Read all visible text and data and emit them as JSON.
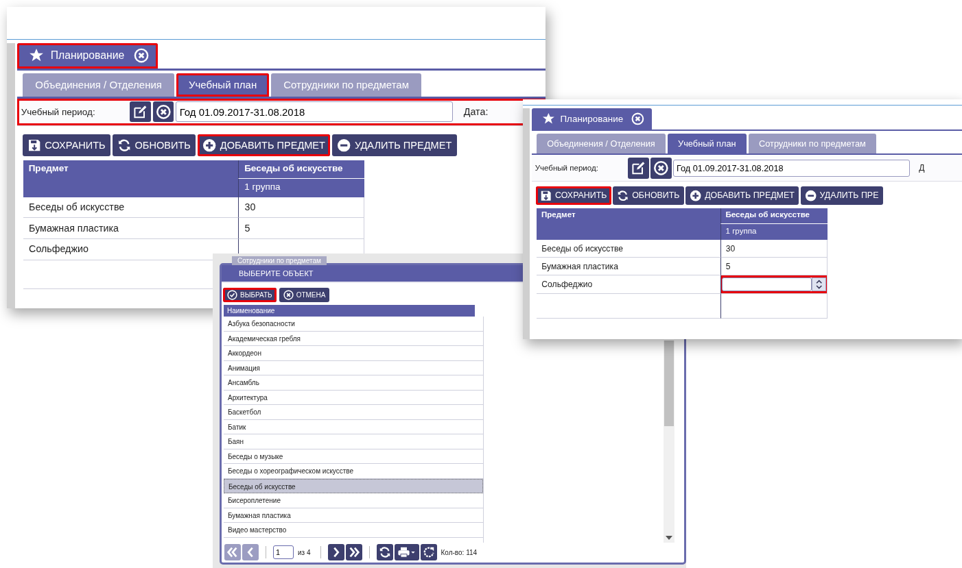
{
  "planning_views": [
    {
      "module_tab": {
        "label": "Планирование",
        "highlighted": true
      },
      "tabs": [
        {
          "label": "Объединения / Отделения",
          "selected": false,
          "highlighted": false
        },
        {
          "label": "Учебный план",
          "selected": true,
          "highlighted": true
        },
        {
          "label": "Сотрудники по предметам",
          "selected": false,
          "highlighted": false
        }
      ],
      "period": {
        "label": "Учебный период:",
        "value": "Год 01.09.2017-31.08.2018",
        "highlighted": true
      },
      "date_label": "Дата:",
      "toolbar": [
        {
          "kind": "save",
          "label": "СОХРАНИТЬ",
          "highlighted": false
        },
        {
          "kind": "refresh",
          "label": "ОБНОВИТЬ",
          "highlighted": false
        },
        {
          "kind": "add",
          "label": "ДОБАВИТЬ ПРЕДМЕТ",
          "highlighted": true
        },
        {
          "kind": "remove",
          "label": "УДАЛИТЬ ПРЕДМЕТ",
          "highlighted": false
        }
      ],
      "table": {
        "columns": [
          "Предмет",
          "Беседы об искусстве"
        ],
        "subheader": "1 группа",
        "rows": [
          {
            "subject": "Беседы об искусстве",
            "value": "30",
            "editing": false,
            "highlighted": false
          },
          {
            "subject": "Бумажная пластика",
            "value": "5",
            "editing": false,
            "highlighted": false
          },
          {
            "subject": "Сольфеджио",
            "editing": false,
            "highlighted": false
          }
        ]
      }
    },
    {
      "module_tab": {
        "label": "Планирование",
        "highlighted": false
      },
      "tabs": [
        {
          "label": "Объединения / Отделения",
          "selected": false,
          "highlighted": false
        },
        {
          "label": "Учебный план",
          "selected": true,
          "highlighted": false
        },
        {
          "label": "Сотрудники по предметам",
          "selected": false,
          "highlighted": false
        }
      ],
      "period": {
        "label": "Учебный период:",
        "value": "Год 01.09.2017-31.08.2018",
        "highlighted": false
      },
      "date_label": "Д",
      "toolbar": [
        {
          "kind": "save",
          "label": "СОХРАНИТЬ",
          "highlighted": true
        },
        {
          "kind": "refresh",
          "label": "ОБНОВИТЬ",
          "highlighted": false
        },
        {
          "kind": "add",
          "label": "ДОБАВИТЬ ПРЕДМЕТ",
          "highlighted": false
        },
        {
          "kind": "remove",
          "label": "УДАЛИТЬ ПРЕ",
          "highlighted": false
        }
      ],
      "table": {
        "columns": [
          "Предмет",
          "Беседы об искусстве"
        ],
        "subheader": "1 группа",
        "rows": [
          {
            "subject": "Беседы об искусстве",
            "value": "30",
            "editing": false,
            "highlighted": false
          },
          {
            "subject": "Бумажная пластика",
            "value": "5",
            "editing": false,
            "highlighted": false
          },
          {
            "subject": "Сольфеджио",
            "editing": true,
            "highlighted": true
          }
        ]
      }
    }
  ],
  "picker_dialog": {
    "background_tab": "Сотрудники по предметам",
    "title": "ВЫБЕРИТЕ ОБЪЕКТ",
    "buttons": [
      {
        "kind": "choose",
        "label": "ВЫБРАТЬ",
        "highlighted": true
      },
      {
        "kind": "cancel",
        "label": "ОТМЕНА",
        "highlighted": false
      }
    ],
    "column": "Наименование",
    "rows": [
      {
        "name": "Азбука безопасности",
        "selected": false
      },
      {
        "name": "Академическая гребля",
        "selected": false
      },
      {
        "name": "Аккордеон",
        "selected": false
      },
      {
        "name": "Анимация",
        "selected": false
      },
      {
        "name": "Ансамбль",
        "selected": false
      },
      {
        "name": "Архитектура",
        "selected": false
      },
      {
        "name": "Баскетбол",
        "selected": false
      },
      {
        "name": "Батик",
        "selected": false
      },
      {
        "name": "Баян",
        "selected": false
      },
      {
        "name": "Беседы о музыке",
        "selected": false
      },
      {
        "name": "Беседы о хореографическом искусстве",
        "selected": false
      },
      {
        "name": "Беседы об искусстве",
        "selected": true
      },
      {
        "name": "Бисероплетение",
        "selected": false
      },
      {
        "name": "Бумажная пластика",
        "selected": false
      },
      {
        "name": "Видео мастерство",
        "selected": false
      }
    ],
    "pager": {
      "buttons": [
        {
          "kind": "first",
          "disabled": true
        },
        {
          "kind": "prev",
          "disabled": true
        },
        {
          "kind": "next",
          "disabled": false
        },
        {
          "kind": "last",
          "disabled": false
        }
      ],
      "page": "1",
      "of_label": "из 4",
      "count_label": "Кол-во: 114"
    }
  }
}
